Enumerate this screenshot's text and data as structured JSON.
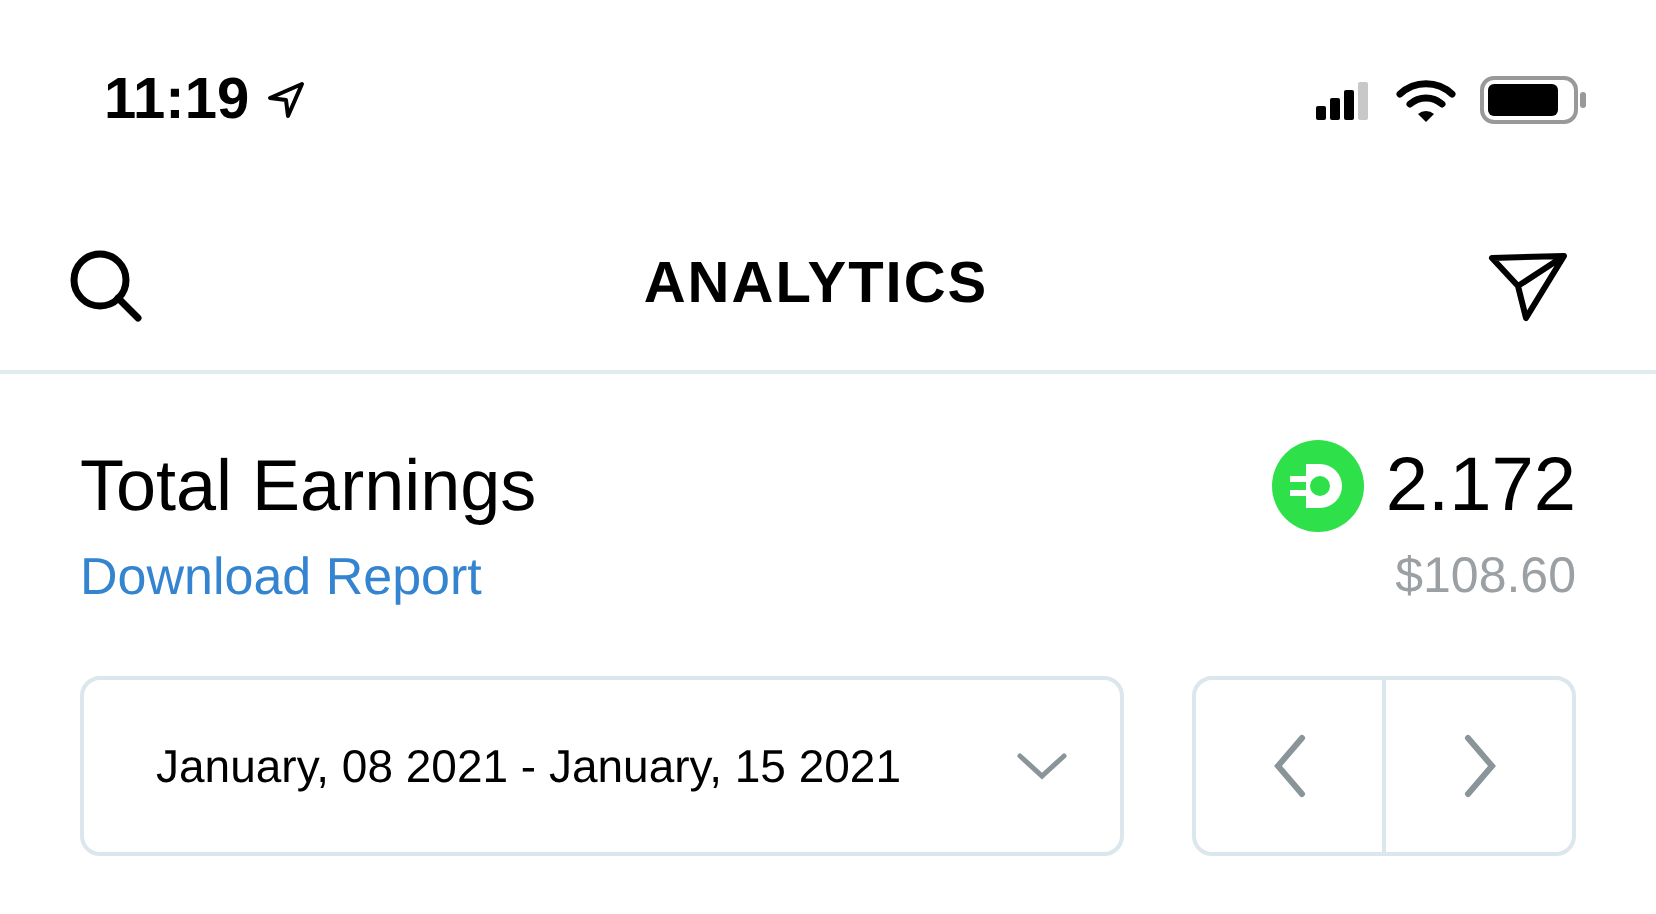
{
  "status_bar": {
    "time": "11:19"
  },
  "header": {
    "title": "ANALYTICS"
  },
  "earnings": {
    "title": "Total Earnings",
    "link": "Download Report",
    "amount": "2.172",
    "fiat": "$108.60"
  },
  "date_range": {
    "value": "January, 08 2021 - January, 15 2021"
  }
}
